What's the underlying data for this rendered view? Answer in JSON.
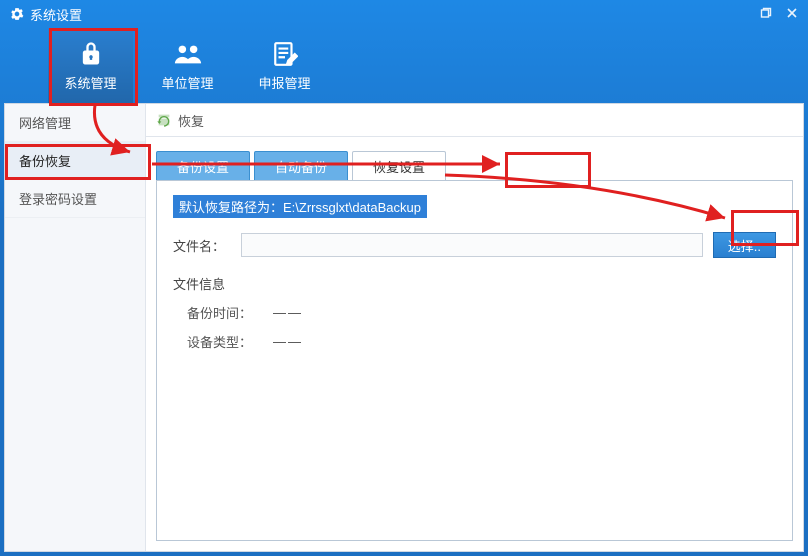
{
  "window": {
    "title": "系统设置"
  },
  "topnav": {
    "items": [
      {
        "label": "系统管理",
        "icon": "lock"
      },
      {
        "label": "单位管理",
        "icon": "org"
      },
      {
        "label": "申报管理",
        "icon": "doc"
      }
    ]
  },
  "sidebar": {
    "items": [
      {
        "label": "网络管理"
      },
      {
        "label": "备份恢复"
      },
      {
        "label": "登录密码设置"
      }
    ]
  },
  "crumb": {
    "label": "恢复"
  },
  "tabs": [
    {
      "label": "备份设置"
    },
    {
      "label": "自动备份"
    },
    {
      "label": "恢复设置"
    }
  ],
  "panel": {
    "notice": "默认恢复路径为：E:\\Zrrssglxt\\dataBackup",
    "filename_label": "文件名：",
    "filename_value": "",
    "select_button": "选择..",
    "fileinfo_title": "文件信息",
    "backup_time_label": "备份时间：",
    "backup_time_value": "——",
    "device_type_label": "设备类型：",
    "device_type_value": "——"
  }
}
